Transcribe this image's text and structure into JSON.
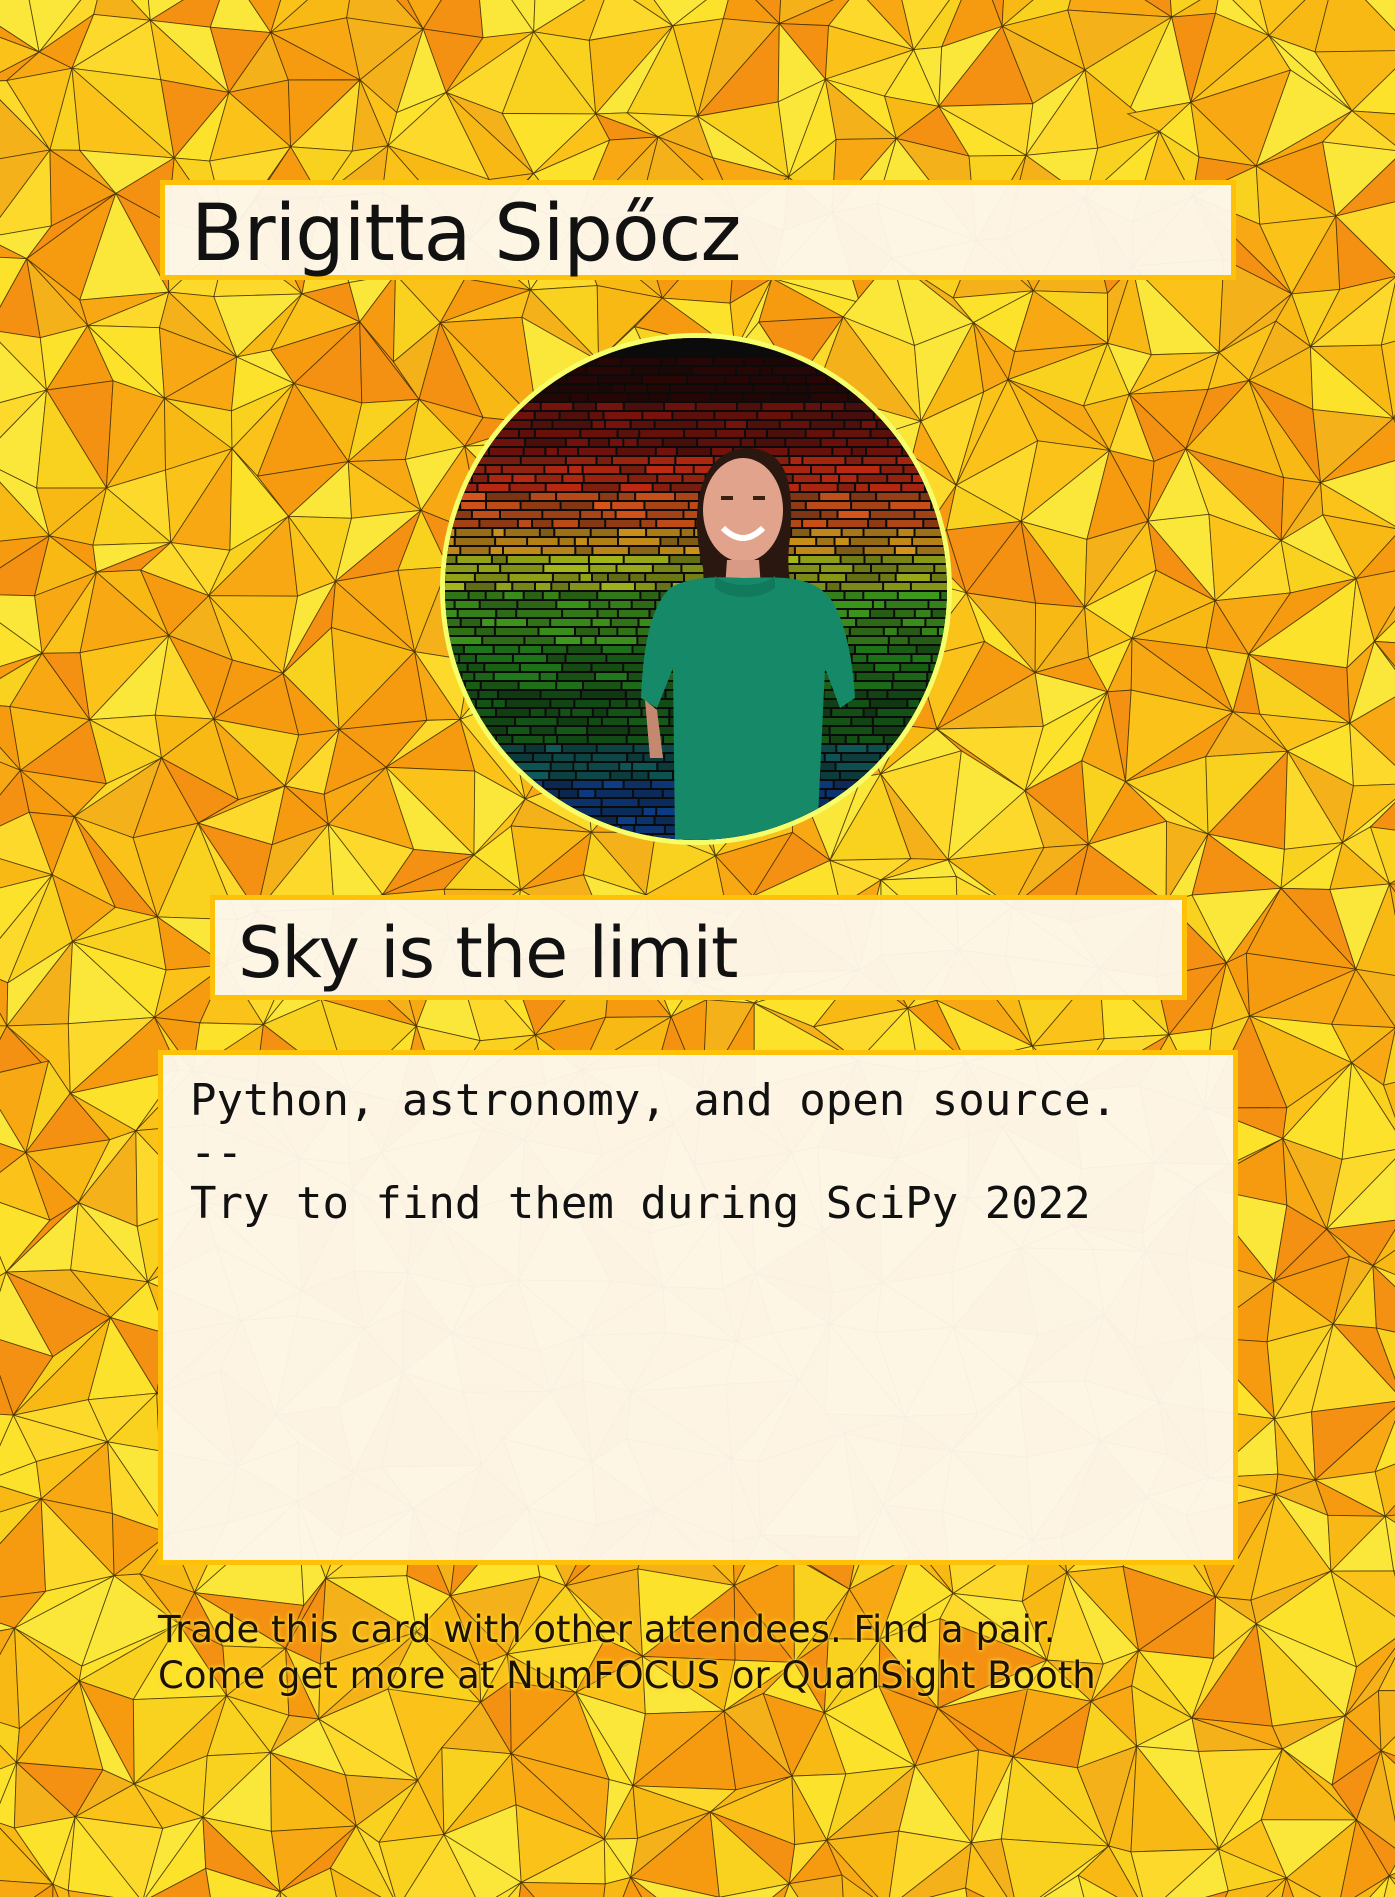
{
  "card": {
    "name": "Brigitta Sipőcz",
    "tagline": "Sky is the limit",
    "description": {
      "line1": "Python, astronomy, and open source.",
      "line2": "--",
      "line3": "Try to find them during SciPy 2022"
    },
    "footer": {
      "line1": "Trade this card with other attendees. Find a pair.",
      "line2": "Come get more at NumFOCUS or QuanSight Booth"
    },
    "photo": "portrait-photo"
  },
  "colors": {
    "background": "#f9b914",
    "accent_border": "#ffc107",
    "photo_ring": "#f5ff6b",
    "panel": "#fdf7ec"
  }
}
